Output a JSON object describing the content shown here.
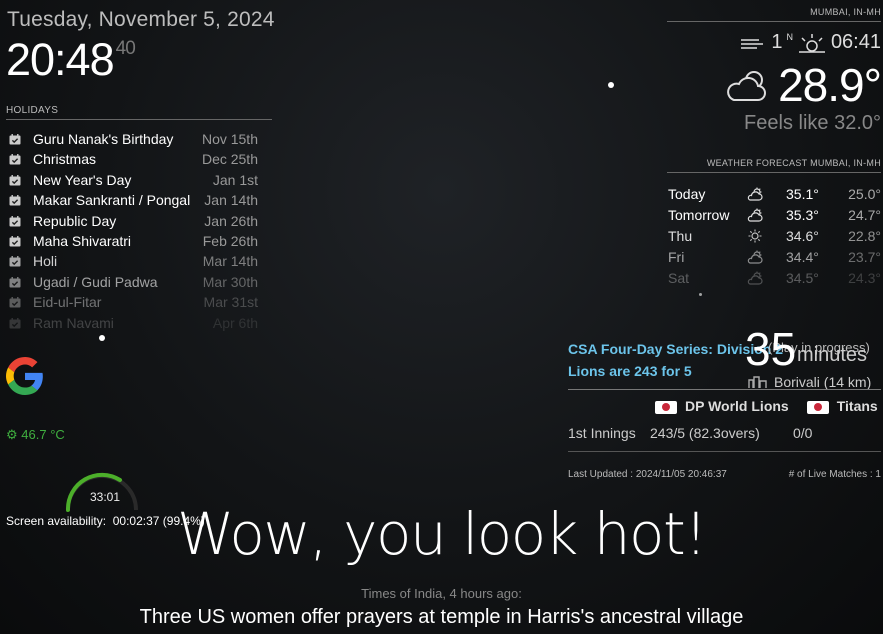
{
  "clock": {
    "date": "Tuesday, November 5, 2024",
    "time": "20:48",
    "seconds": "40"
  },
  "holidays": {
    "header": "HOLIDAYS",
    "items": [
      {
        "name": "Guru Nanak's Birthday",
        "date": "Nov 15th"
      },
      {
        "name": "Christmas",
        "date": "Dec 25th"
      },
      {
        "name": "New Year's Day",
        "date": "Jan 1st"
      },
      {
        "name": "Makar Sankranti / Pongal",
        "date": "Jan 14th"
      },
      {
        "name": "Republic Day",
        "date": "Jan 26th"
      },
      {
        "name": "Maha Shivaratri",
        "date": "Feb 26th"
      },
      {
        "name": "Holi",
        "date": "Mar 14th"
      },
      {
        "name": "Ugadi / Gudi Padwa",
        "date": "Mar 30th"
      },
      {
        "name": "Eid-ul-Fitar",
        "date": "Mar 31st"
      },
      {
        "name": "Ram Navami",
        "date": "Apr 6th"
      }
    ]
  },
  "system": {
    "cpu_temp": "46.7 °C",
    "gauge_value": "33:01",
    "screen_label": "Screen availability:",
    "screen_value": "00:02:37 (99.4%)"
  },
  "weather": {
    "location": "MUMBAI, IN-MH",
    "wind": "1",
    "wind_dir": "N",
    "sunset": "06:41",
    "temperature": "28.9°",
    "feels_like": "Feels like 32.0°",
    "forecast_header": "WEATHER FORECAST MUMBAI, IN-MH",
    "forecast": [
      {
        "day": "Today",
        "icon": "partly-cloudy-icon",
        "high": "35.1°",
        "low": "25.0°"
      },
      {
        "day": "Tomorrow",
        "icon": "partly-cloudy-icon",
        "high": "35.3°",
        "low": "24.7°"
      },
      {
        "day": "Thu",
        "icon": "sun-icon",
        "high": "34.6°",
        "low": "22.8°"
      },
      {
        "day": "Fri",
        "icon": "partly-cloudy-icon",
        "high": "34.4°",
        "low": "23.7°"
      },
      {
        "day": "Sat",
        "icon": "partly-cloudy-icon",
        "high": "34.5°",
        "low": "24.3°"
      }
    ]
  },
  "cricket": {
    "title_line1": "CSA Four-Day Series: Division 2",
    "title_line2": "Lions are 243 for 5",
    "play_status": "(Play in progress)",
    "travel_minutes": "35",
    "travel_unit": "minutes",
    "travel_place": "Borivali (14 km)",
    "team1": "DP World Lions",
    "team2": "Titans",
    "innings": "1st Innings",
    "score1": "243/5 (82.3overs)",
    "score2": "0/0",
    "last_updated": "Last Updated : 2024/11/05 20:46:37",
    "live_matches": "# of Live Matches : 1"
  },
  "compliment": "Wow, you look hot!",
  "news": {
    "source": "Times of India, 4 hours ago:",
    "title": "Three US women offer prayers at temple in Harris's ancestral village"
  }
}
